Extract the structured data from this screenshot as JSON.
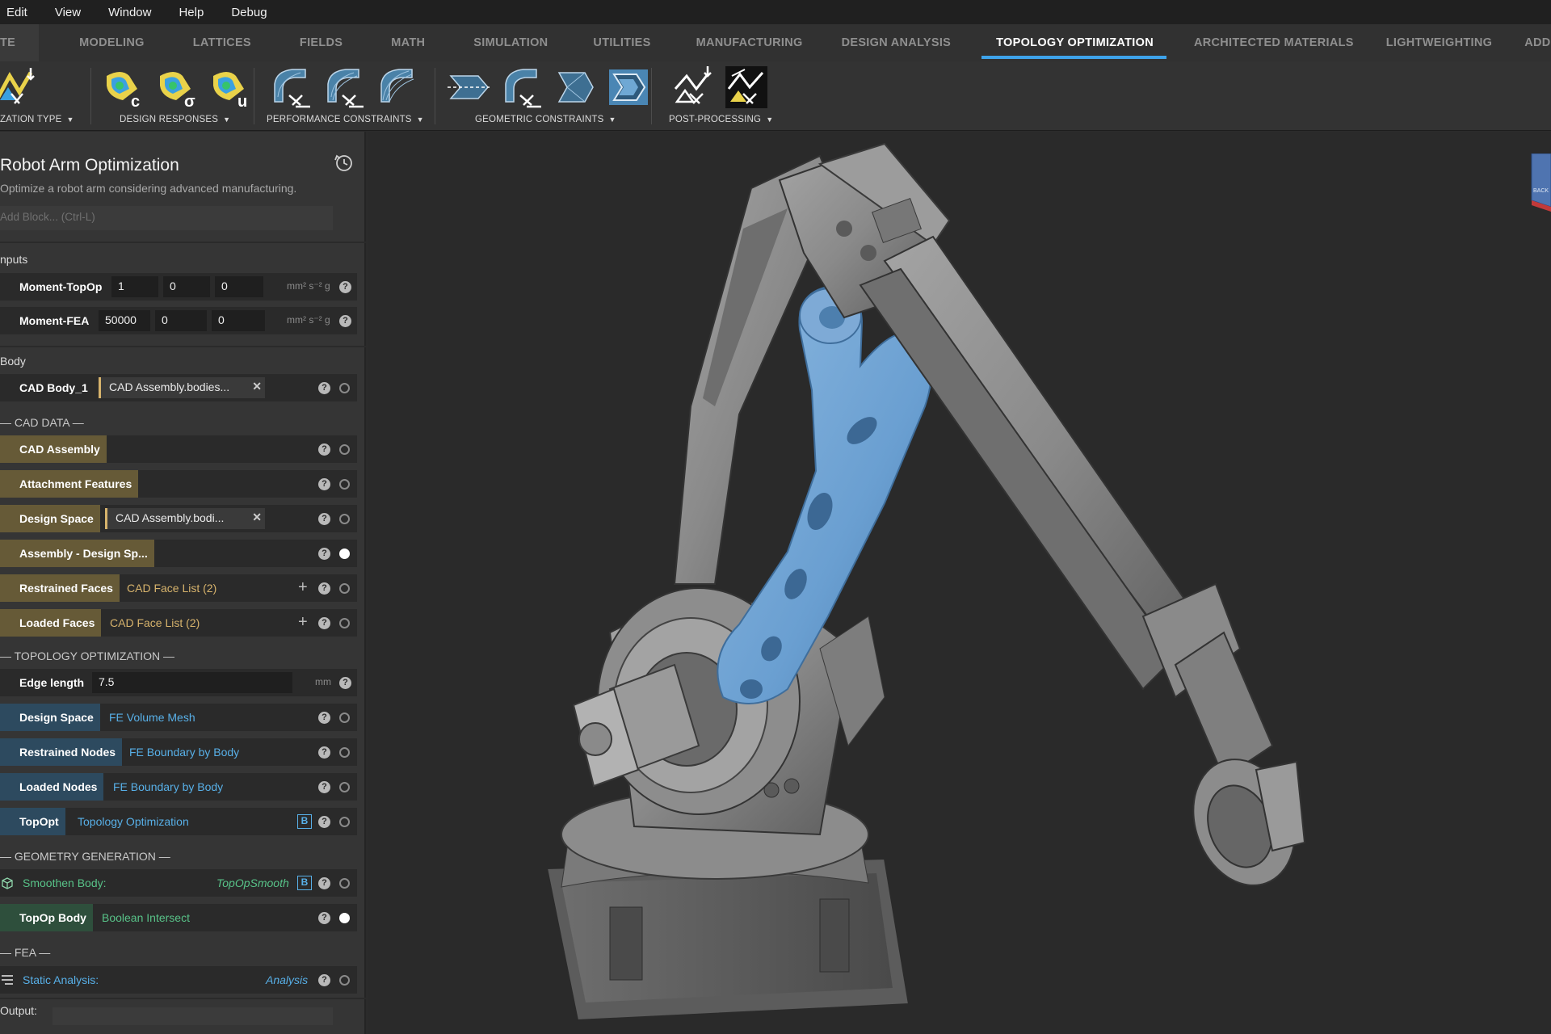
{
  "menu": {
    "items": [
      "Edit",
      "View",
      "Window",
      "Help",
      "Debug"
    ]
  },
  "tabs": [
    {
      "label": "TE"
    },
    {
      "label": "MODELING"
    },
    {
      "label": "LATTICES"
    },
    {
      "label": "FIELDS"
    },
    {
      "label": "MATH"
    },
    {
      "label": "SIMULATION"
    },
    {
      "label": "UTILITIES"
    },
    {
      "label": "MANUFACTURING"
    },
    {
      "label": "DESIGN ANALYSIS"
    },
    {
      "label": "TOPOLOGY OPTIMIZATION",
      "active": true
    },
    {
      "label": "ARCHITECTED MATERIALS"
    },
    {
      "label": "LIGHTWEIGHTING"
    },
    {
      "label": "ADDITIVE MANUFACT"
    }
  ],
  "ribbon": {
    "groups": [
      {
        "label": "ZATION TYPE",
        "icons": [
          "optimization-type-icon"
        ]
      },
      {
        "label": "DESIGN RESPONSES",
        "icons": [
          "compliance-response-icon",
          "objective-response-icon",
          "utility-response-icon"
        ]
      },
      {
        "label": "PERFORMANCE CONSTRAINTS",
        "icons": [
          "stress-constraint-icon",
          "displacement-constraint-icon",
          "frequency-constraint-icon"
        ]
      },
      {
        "label": "GEOMETRIC CONSTRAINTS",
        "icons": [
          "symmetry-constraint-icon",
          "overhang-constraint-icon",
          "extrusion-constraint-icon",
          "thickness-constraint-icon"
        ]
      },
      {
        "label": "POST-PROCESSING",
        "icons": [
          "smoothing-icon",
          "export-result-icon"
        ]
      }
    ]
  },
  "panel": {
    "title": "Robot Arm Optimization",
    "subtitle": "Optimize a robot arm considering advanced manufacturing.",
    "add_block_placeholder": "Add Block... (Ctrl-L)",
    "inputs_label": "nputs",
    "inputs": [
      {
        "name": "Moment-TopOp",
        "values": [
          "1",
          "0",
          "0"
        ],
        "unit": "mm² s⁻² g"
      },
      {
        "name": "Moment-FEA",
        "values": [
          "50000",
          "0",
          "0"
        ],
        "unit": "mm² s⁻² g"
      }
    ],
    "body_label": "Body",
    "cad_body": {
      "name": "CAD Body_1",
      "value": "CAD Assembly.bodies..."
    },
    "cad_data_label": "— CAD DATA —",
    "cad_data": [
      {
        "name": "CAD Assembly",
        "value": ""
      },
      {
        "name": "Attachment Features",
        "value": ""
      },
      {
        "name": "Design Space",
        "value": "CAD Assembly.bodi..."
      },
      {
        "name": "Assembly - Design Sp...",
        "value": ""
      },
      {
        "name": "Restrained Faces",
        "value": "CAD Face List (2)"
      },
      {
        "name": "Loaded Faces",
        "value": "CAD Face List (2)"
      }
    ],
    "topopt_label": "— TOPOLOGY OPTIMIZATION —",
    "edge_length": {
      "name": "Edge length",
      "value": "7.5",
      "unit": "mm"
    },
    "topopt": [
      {
        "name": "Design Space",
        "value": "FE Volume Mesh"
      },
      {
        "name": "Restrained Nodes",
        "value": "FE Boundary by Body"
      },
      {
        "name": "Loaded Nodes",
        "value": "FE Boundary by Body"
      },
      {
        "name": "TopOpt",
        "value": "Topology Optimization",
        "badge": "B"
      }
    ],
    "geometry_label": "— GEOMETRY GENERATION —",
    "geometry": [
      {
        "name": "Smoothen Body:",
        "value": "TopOpSmooth",
        "badge": "B"
      },
      {
        "name": "TopOp Body",
        "value": "Boolean Intersect"
      }
    ],
    "fea_label": "— FEA —",
    "fea": [
      {
        "name": "Static Analysis:",
        "value": "Analysis"
      }
    ],
    "output_label": "Output:",
    "help_glyph": "?",
    "remove_glyph": "✕",
    "add_glyph": "+"
  },
  "viewport": {
    "navcube_label": "BACK",
    "colors": {
      "background": "#2a2a2a",
      "metal": "#8e8e8e",
      "optimized_part": "#6a9fd1"
    }
  }
}
